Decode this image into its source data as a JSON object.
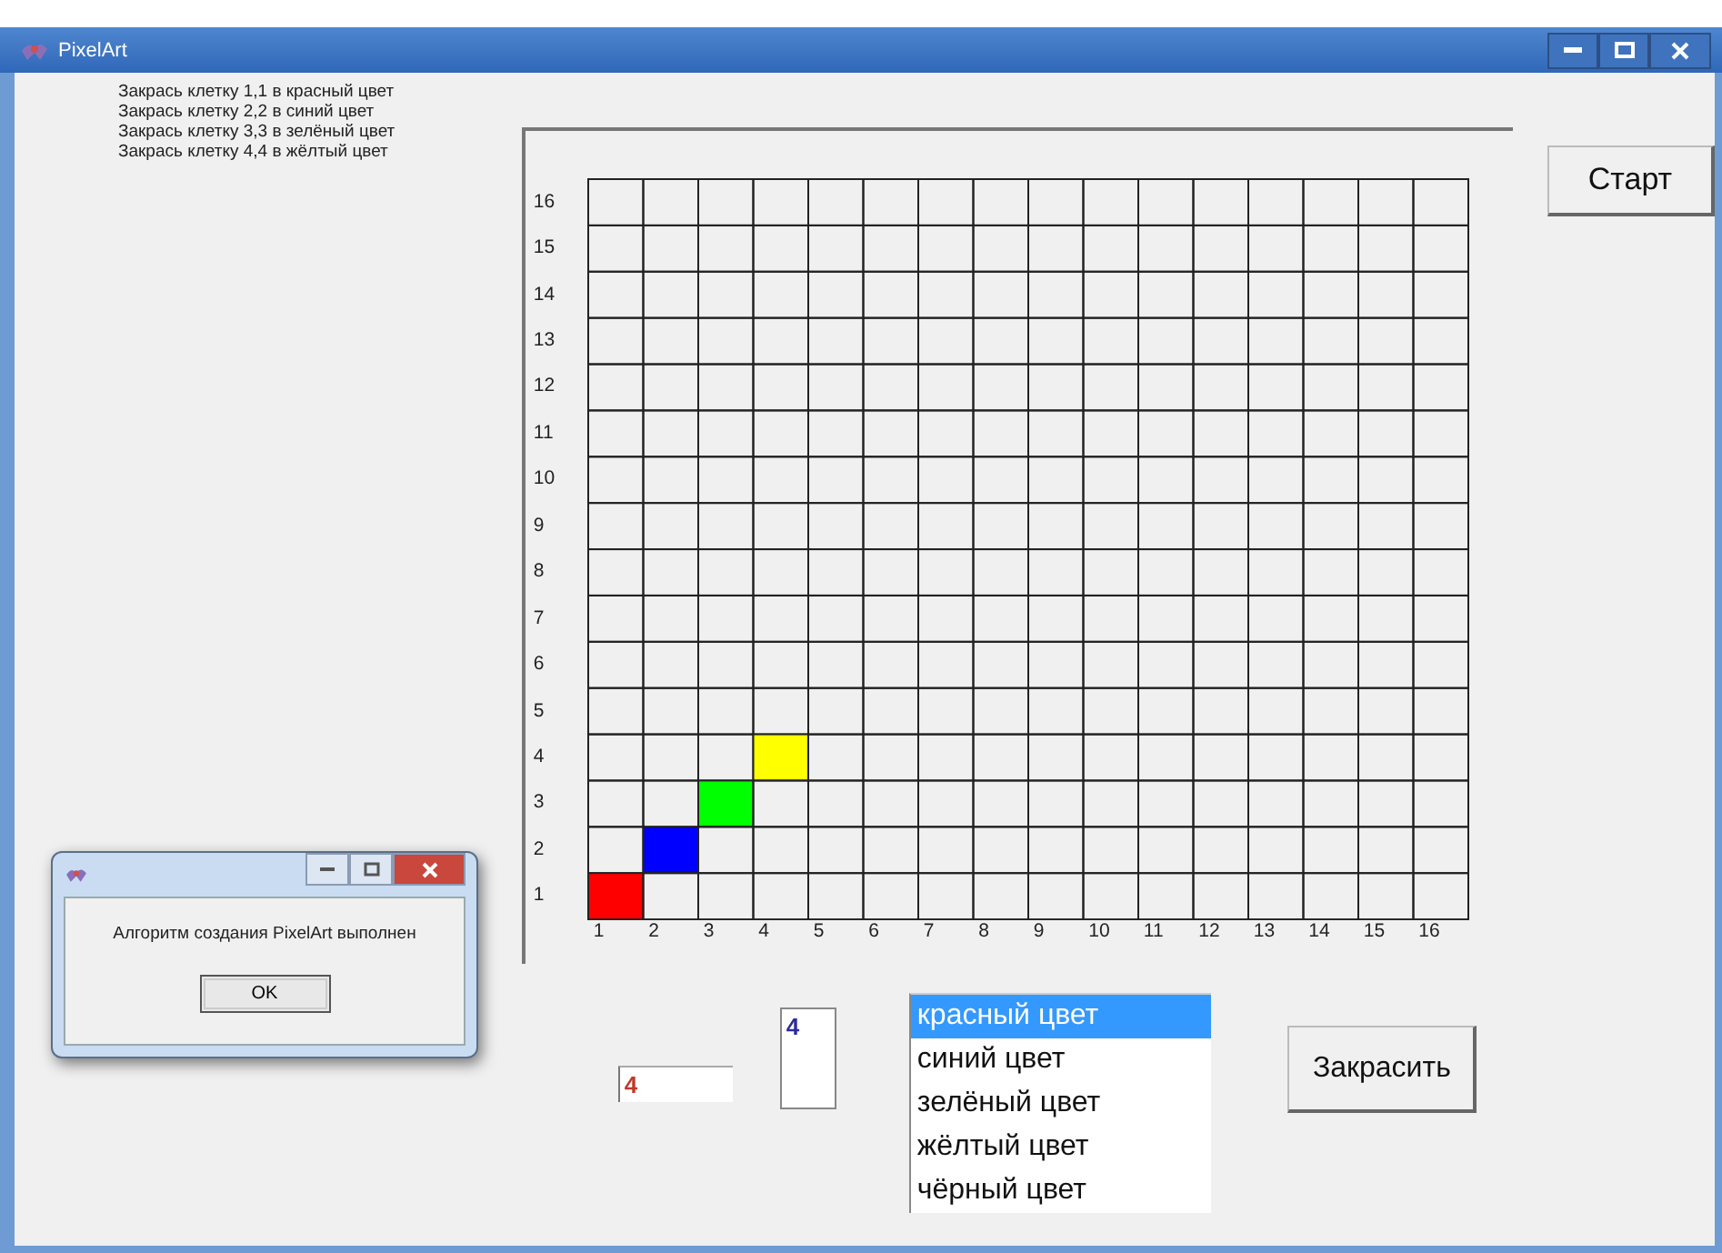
{
  "window": {
    "title": "PixelArt"
  },
  "instructions": [
    "Закрась клетку 1,1 в красный цвет",
    "Закрась клетку 2,2 в синий цвет",
    "Закрась клетку 3,3 в зелёный цвет",
    "Закрась клетку 4,4 в жёлтый цвет"
  ],
  "grid": {
    "rows": [
      {
        "label": "16",
        "cells": [
          {
            "painted": false
          },
          {
            "painted": false
          },
          {
            "painted": false
          },
          {
            "painted": false
          },
          {
            "painted": false
          },
          {
            "painted": false
          },
          {
            "painted": false
          },
          {
            "painted": false
          },
          {
            "painted": false
          },
          {
            "painted": false
          },
          {
            "painted": false
          },
          {
            "painted": false
          },
          {
            "painted": false
          },
          {
            "painted": false
          },
          {
            "painted": false
          },
          {
            "painted": false
          }
        ]
      },
      {
        "label": "15",
        "cells": [
          {
            "painted": false
          },
          {
            "painted": false
          },
          {
            "painted": false
          },
          {
            "painted": false
          },
          {
            "painted": false
          },
          {
            "painted": false
          },
          {
            "painted": false
          },
          {
            "painted": false
          },
          {
            "painted": false
          },
          {
            "painted": false
          },
          {
            "painted": false
          },
          {
            "painted": false
          },
          {
            "painted": false
          },
          {
            "painted": false
          },
          {
            "painted": false
          },
          {
            "painted": false
          }
        ]
      },
      {
        "label": "14",
        "cells": [
          {
            "painted": false
          },
          {
            "painted": false
          },
          {
            "painted": false
          },
          {
            "painted": false
          },
          {
            "painted": false
          },
          {
            "painted": false
          },
          {
            "painted": false
          },
          {
            "painted": false
          },
          {
            "painted": false
          },
          {
            "painted": false
          },
          {
            "painted": false
          },
          {
            "painted": false
          },
          {
            "painted": false
          },
          {
            "painted": false
          },
          {
            "painted": false
          },
          {
            "painted": false
          }
        ]
      },
      {
        "label": "13",
        "cells": [
          {
            "painted": false
          },
          {
            "painted": false
          },
          {
            "painted": false
          },
          {
            "painted": false
          },
          {
            "painted": false
          },
          {
            "painted": false
          },
          {
            "painted": false
          },
          {
            "painted": false
          },
          {
            "painted": false
          },
          {
            "painted": false
          },
          {
            "painted": false
          },
          {
            "painted": false
          },
          {
            "painted": false
          },
          {
            "painted": false
          },
          {
            "painted": false
          },
          {
            "painted": false
          }
        ]
      },
      {
        "label": "12",
        "cells": [
          {
            "painted": false
          },
          {
            "painted": false
          },
          {
            "painted": false
          },
          {
            "painted": false
          },
          {
            "painted": false
          },
          {
            "painted": false
          },
          {
            "painted": false
          },
          {
            "painted": false
          },
          {
            "painted": false
          },
          {
            "painted": false
          },
          {
            "painted": false
          },
          {
            "painted": false
          },
          {
            "painted": false
          },
          {
            "painted": false
          },
          {
            "painted": false
          },
          {
            "painted": false
          }
        ]
      },
      {
        "label": "11",
        "cells": [
          {
            "painted": false
          },
          {
            "painted": false
          },
          {
            "painted": false
          },
          {
            "painted": false
          },
          {
            "painted": false
          },
          {
            "painted": false
          },
          {
            "painted": false
          },
          {
            "painted": false
          },
          {
            "painted": false
          },
          {
            "painted": false
          },
          {
            "painted": false
          },
          {
            "painted": false
          },
          {
            "painted": false
          },
          {
            "painted": false
          },
          {
            "painted": false
          },
          {
            "painted": false
          }
        ]
      },
      {
        "label": "10",
        "cells": [
          {
            "painted": false
          },
          {
            "painted": false
          },
          {
            "painted": false
          },
          {
            "painted": false
          },
          {
            "painted": false
          },
          {
            "painted": false
          },
          {
            "painted": false
          },
          {
            "painted": false
          },
          {
            "painted": false
          },
          {
            "painted": false
          },
          {
            "painted": false
          },
          {
            "painted": false
          },
          {
            "painted": false
          },
          {
            "painted": false
          },
          {
            "painted": false
          },
          {
            "painted": false
          }
        ]
      },
      {
        "label": "9",
        "cells": [
          {
            "painted": false
          },
          {
            "painted": false
          },
          {
            "painted": false
          },
          {
            "painted": false
          },
          {
            "painted": false
          },
          {
            "painted": false
          },
          {
            "painted": false
          },
          {
            "painted": false
          },
          {
            "painted": false
          },
          {
            "painted": false
          },
          {
            "painted": false
          },
          {
            "painted": false
          },
          {
            "painted": false
          },
          {
            "painted": false
          },
          {
            "painted": false
          },
          {
            "painted": false
          }
        ]
      },
      {
        "label": "8",
        "cells": [
          {
            "painted": false
          },
          {
            "painted": false
          },
          {
            "painted": false
          },
          {
            "painted": false
          },
          {
            "painted": false
          },
          {
            "painted": false
          },
          {
            "painted": false
          },
          {
            "painted": false
          },
          {
            "painted": false
          },
          {
            "painted": false
          },
          {
            "painted": false
          },
          {
            "painted": false
          },
          {
            "painted": false
          },
          {
            "painted": false
          },
          {
            "painted": false
          },
          {
            "painted": false
          }
        ]
      },
      {
        "label": "7",
        "cells": [
          {
            "painted": false
          },
          {
            "painted": false
          },
          {
            "painted": false
          },
          {
            "painted": false
          },
          {
            "painted": false
          },
          {
            "painted": false
          },
          {
            "painted": false
          },
          {
            "painted": false
          },
          {
            "painted": false
          },
          {
            "painted": false
          },
          {
            "painted": false
          },
          {
            "painted": false
          },
          {
            "painted": false
          },
          {
            "painted": false
          },
          {
            "painted": false
          },
          {
            "painted": false
          }
        ]
      },
      {
        "label": "6",
        "cells": [
          {
            "painted": false
          },
          {
            "painted": false
          },
          {
            "painted": false
          },
          {
            "painted": false
          },
          {
            "painted": false
          },
          {
            "painted": false
          },
          {
            "painted": false
          },
          {
            "painted": false
          },
          {
            "painted": false
          },
          {
            "painted": false
          },
          {
            "painted": false
          },
          {
            "painted": false
          },
          {
            "painted": false
          },
          {
            "painted": false
          },
          {
            "painted": false
          },
          {
            "painted": false
          }
        ]
      },
      {
        "label": "5",
        "cells": [
          {
            "painted": false
          },
          {
            "painted": false
          },
          {
            "painted": false
          },
          {
            "painted": false
          },
          {
            "painted": false
          },
          {
            "painted": false
          },
          {
            "painted": false
          },
          {
            "painted": false
          },
          {
            "painted": false
          },
          {
            "painted": false
          },
          {
            "painted": false
          },
          {
            "painted": false
          },
          {
            "painted": false
          },
          {
            "painted": false
          },
          {
            "painted": false
          },
          {
            "painted": false
          }
        ]
      },
      {
        "label": "4",
        "cells": [
          {
            "painted": false
          },
          {
            "painted": false
          },
          {
            "painted": false
          },
          {
            "painted": true,
            "color": "#ffff00"
          },
          {
            "painted": false
          },
          {
            "painted": false
          },
          {
            "painted": false
          },
          {
            "painted": false
          },
          {
            "painted": false
          },
          {
            "painted": false
          },
          {
            "painted": false
          },
          {
            "painted": false
          },
          {
            "painted": false
          },
          {
            "painted": false
          },
          {
            "painted": false
          },
          {
            "painted": false
          }
        ]
      },
      {
        "label": "3",
        "cells": [
          {
            "painted": false
          },
          {
            "painted": false
          },
          {
            "painted": true,
            "color": "#00ff00"
          },
          {
            "painted": false
          },
          {
            "painted": false
          },
          {
            "painted": false
          },
          {
            "painted": false
          },
          {
            "painted": false
          },
          {
            "painted": false
          },
          {
            "painted": false
          },
          {
            "painted": false
          },
          {
            "painted": false
          },
          {
            "painted": false
          },
          {
            "painted": false
          },
          {
            "painted": false
          },
          {
            "painted": false
          }
        ]
      },
      {
        "label": "2",
        "cells": [
          {
            "painted": false
          },
          {
            "painted": true,
            "color": "#0000ff"
          },
          {
            "painted": false
          },
          {
            "painted": false
          },
          {
            "painted": false
          },
          {
            "painted": false
          },
          {
            "painted": false
          },
          {
            "painted": false
          },
          {
            "painted": false
          },
          {
            "painted": false
          },
          {
            "painted": false
          },
          {
            "painted": false
          },
          {
            "painted": false
          },
          {
            "painted": false
          },
          {
            "painted": false
          },
          {
            "painted": false
          }
        ]
      },
      {
        "label": "1",
        "cells": [
          {
            "painted": true,
            "color": "#ff0000"
          },
          {
            "painted": false
          },
          {
            "painted": false
          },
          {
            "painted": false
          },
          {
            "painted": false
          },
          {
            "painted": false
          },
          {
            "painted": false
          },
          {
            "painted": false
          },
          {
            "painted": false
          },
          {
            "painted": false
          },
          {
            "painted": false
          },
          {
            "painted": false
          },
          {
            "painted": false
          },
          {
            "painted": false
          },
          {
            "painted": false
          },
          {
            "painted": false
          }
        ]
      }
    ],
    "column_labels": [
      "1",
      "2",
      "3",
      "4",
      "5",
      "6",
      "7",
      "8",
      "9",
      "10",
      "11",
      "12",
      "13",
      "14",
      "15",
      "16"
    ]
  },
  "start_button": "Старт",
  "x_field": {
    "value": "4"
  },
  "y_field": {
    "value": "4"
  },
  "color_list": [
    {
      "label": "красный цвет",
      "selected": true
    },
    {
      "label": "синий цвет",
      "selected": false
    },
    {
      "label": "зелёный цвет",
      "selected": false
    },
    {
      "label": "жёлтый цвет",
      "selected": false
    },
    {
      "label": "чёрный цвет",
      "selected": false
    }
  ],
  "paint_button": "Закрасить",
  "dialog": {
    "message": "Алгоритм создания PixelArt выполнен",
    "ok_button": "OK"
  }
}
